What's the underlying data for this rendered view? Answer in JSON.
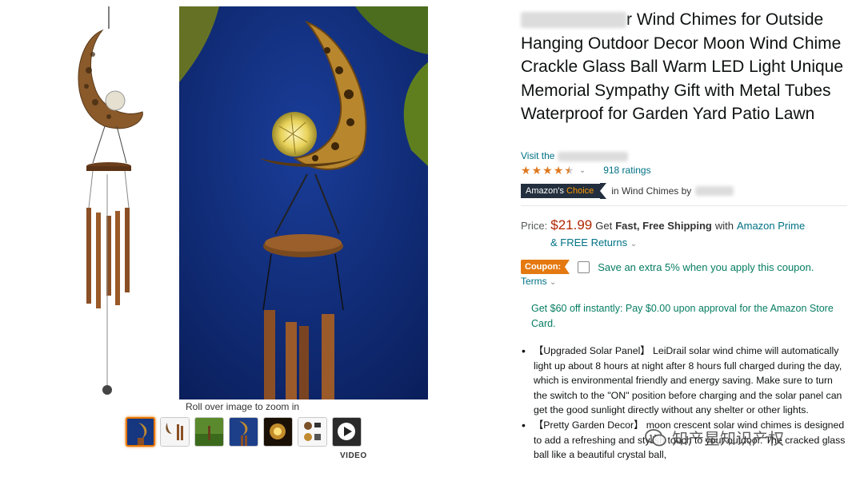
{
  "product": {
    "title_suffix": "r Wind Chimes for Outside Hanging Outdoor Decor Moon Wind Chime Crackle Glass Ball Warm LED Light Unique Memorial Sympathy Gift with Metal Tubes Waterproof for Garden Yard Patio Lawn",
    "visit_prefix": "Visit the",
    "rating_count": "918 ratings",
    "stars_value": 4.5,
    "badge_part1": "Amazon's",
    "badge_part2": "Choice",
    "badge_category": "in Wind Chimes by"
  },
  "gallery": {
    "rollover_text": "Roll over image to zoom in",
    "video_label": "VIDEO"
  },
  "pricing": {
    "label": "Price:",
    "price": "$21.99",
    "get": "Get",
    "shipping": "Fast, Free Shipping",
    "with": "with",
    "prime": "Amazon Prime",
    "returns": "& FREE Returns",
    "returns_chevron": "⌄"
  },
  "coupon": {
    "badge": "Coupon:",
    "text": "Save an extra 5% when you apply this coupon.",
    "terms": "Terms"
  },
  "card_offer": "Get $60 off instantly: Pay $0.00 upon approval for the Amazon Store Card.",
  "bullets": [
    "【Upgraded Solar Panel】 LeiDrail solar wind chime will automatically light up about 8 hours at night after 8 hours full charged during the day, which is environmental friendly and energy saving. Make sure to turn the switch to the \"ON\" position before charging and the solar panel can get the good sunlight directly without any shelter or other lights.",
    "【Pretty Garden Decor】 moon crescent solar wind chimes is designed to add a refreshing and stylish touch to your outdoor. The cracked glass ball like a beautiful crystal ball,"
  ],
  "watermark": "知产星知识产权",
  "colors": {
    "link": "#007185",
    "price": "#b12704",
    "star": "#de7921",
    "coupon": "#e47911",
    "green": "#067d62"
  }
}
